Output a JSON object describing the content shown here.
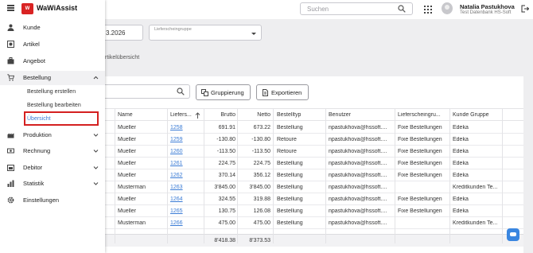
{
  "header": {
    "app_name": "WaWiAssist",
    "logo_mark": "W",
    "search_placeholder": "Suchen",
    "user_name": "Natalia Pastukhova",
    "user_db": "Test Datenbank HS-Soft"
  },
  "sidebar": {
    "items": [
      {
        "label": "Kunde",
        "icon": "person-icon"
      },
      {
        "label": "Artikel",
        "icon": "box-icon"
      },
      {
        "label": "Angebot",
        "icon": "briefcase-icon"
      },
      {
        "label": "Bestellung",
        "icon": "cart-icon"
      },
      {
        "label": "Produktion",
        "icon": "factory-icon"
      },
      {
        "label": "Rechnung",
        "icon": "money-icon"
      },
      {
        "label": "Debitor",
        "icon": "wallet-icon"
      },
      {
        "label": "Statistik",
        "icon": "chart-icon"
      },
      {
        "label": "Einstellungen",
        "icon": "gear-icon"
      }
    ],
    "subitems": [
      "Bestellung erstellen",
      "Bestellung bearbeiten",
      "Übersicht"
    ]
  },
  "filters": {
    "date_value": "3.2026",
    "lieferscheingruppe_label": "Lieferscheingruppe"
  },
  "tab_label": "rtikelübersicht",
  "toolbar": {
    "group_label": "Gruppierung",
    "export_label": "Exportieren"
  },
  "table": {
    "columns": [
      "Name",
      "Liefers...",
      "Brutto",
      "Netto",
      "Bestelltyp",
      "Benutzer",
      "Lieferscheingru...",
      "Kunde Gruppe"
    ],
    "rows": [
      [
        "Mueller",
        "1258",
        "691.91",
        "673.22",
        "Bestellung",
        "npastukhova@hssoft....",
        "Fixe Bestellungen",
        "Edeka"
      ],
      [
        "Mueller",
        "1259",
        "-130.80",
        "-130.80",
        "Retoure",
        "npastukhova@hssoft....",
        "Fixe Bestellungen",
        "Edeka"
      ],
      [
        "Mueller",
        "1260",
        "-113.50",
        "-113.50",
        "Retoure",
        "npastukhova@hssoft....",
        "Fixe Bestellungen",
        "Edeka"
      ],
      [
        "Mueller",
        "1261",
        "224.75",
        "224.75",
        "Bestellung",
        "npastukhova@hssoft....",
        "Fixe Bestellungen",
        "Edeka"
      ],
      [
        "Mueller",
        "1262",
        "370.14",
        "356.12",
        "Bestellung",
        "npastukhova@hssoft....",
        "Fixe Bestellungen",
        "Edeka"
      ],
      [
        "Musterman",
        "1263",
        "3'845.00",
        "3'845.00",
        "Bestellung",
        "npastukhova@hssoft....",
        "",
        "Kreditkunden Te..."
      ],
      [
        "Mueller",
        "1264",
        "324.55",
        "319.88",
        "Bestellung",
        "npastukhova@hssoft....",
        "Fixe Bestellungen",
        "Edeka"
      ],
      [
        "Mueller",
        "1265",
        "130.75",
        "126.08",
        "Bestellung",
        "npastukhova@hssoft....",
        "Fixe Bestellungen",
        "Edeka"
      ],
      [
        "Musterman",
        "1266",
        "475.00",
        "475.00",
        "Bestellung",
        "npastukhova@hssoft....",
        "",
        "Kreditkunden Te..."
      ]
    ],
    "totals": {
      "brutto": "8'418.38",
      "netto": "8'373.53"
    }
  }
}
